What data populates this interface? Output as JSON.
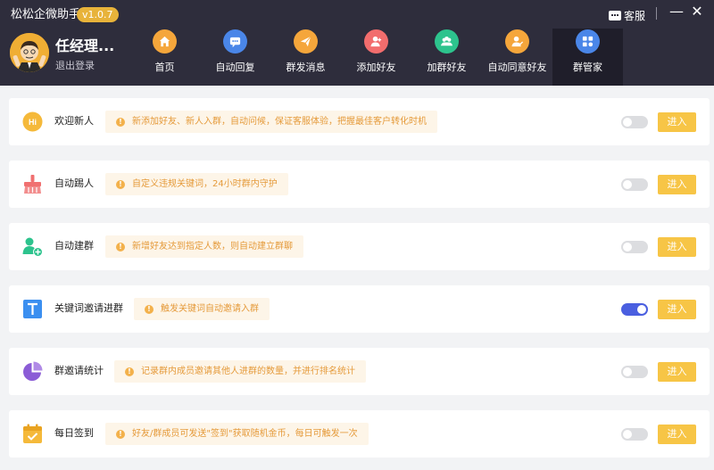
{
  "app": {
    "title": "松松企微助手",
    "version": "v1.0.7"
  },
  "window": {
    "service_label": "客服",
    "minimize": "—",
    "close": "✕"
  },
  "user": {
    "name": "任经理...",
    "logout": "退出登录"
  },
  "nav": [
    {
      "label": "首页",
      "icon": "home-icon",
      "color": "#f5a63b"
    },
    {
      "label": "自动回复",
      "icon": "chat-icon",
      "color": "#4a86e8"
    },
    {
      "label": "群发消息",
      "icon": "send-icon",
      "color": "#f5a63b"
    },
    {
      "label": "添加好友",
      "icon": "add-user-icon",
      "color": "#f26d6d"
    },
    {
      "label": "加群好友",
      "icon": "group-icon",
      "color": "#2dc38d"
    },
    {
      "label": "自动同意好友",
      "icon": "user-check-icon",
      "color": "#f5a63b"
    },
    {
      "label": "群管家",
      "icon": "grid-icon",
      "color": "#4a86e8",
      "active": true
    }
  ],
  "features": [
    {
      "title": "欢迎新人",
      "desc": "新添加好友、新人入群，自动问候，保证客服体验，把握最佳客户转化时机",
      "enabled": false,
      "icon": "welcome-icon"
    },
    {
      "title": "自动踢人",
      "desc": "自定义违规关键词，24小时群内守护",
      "enabled": false,
      "icon": "broom-icon"
    },
    {
      "title": "自动建群",
      "desc": "新增好友达到指定人数，则自动建立群聊",
      "enabled": false,
      "icon": "create-group-icon"
    },
    {
      "title": "关键词邀请进群",
      "desc": "触发关键词自动邀请入群",
      "enabled": true,
      "icon": "keyword-icon"
    },
    {
      "title": "群邀请统计",
      "desc": "记录群内成员邀请其他人进群的数量，并进行排名统计",
      "enabled": false,
      "icon": "pie-chart-icon"
    },
    {
      "title": "每日签到",
      "desc": "好友/群成员可发送\"签到\"获取随机金币，每日可触发一次",
      "enabled": false,
      "icon": "calendar-icon"
    }
  ],
  "enter_label": "进入",
  "colors": {
    "header_bg": "#2e2d3c",
    "accent_yellow": "#f7c546",
    "toggle_on": "#4a5fe0",
    "desc_text": "#e59a3a"
  }
}
